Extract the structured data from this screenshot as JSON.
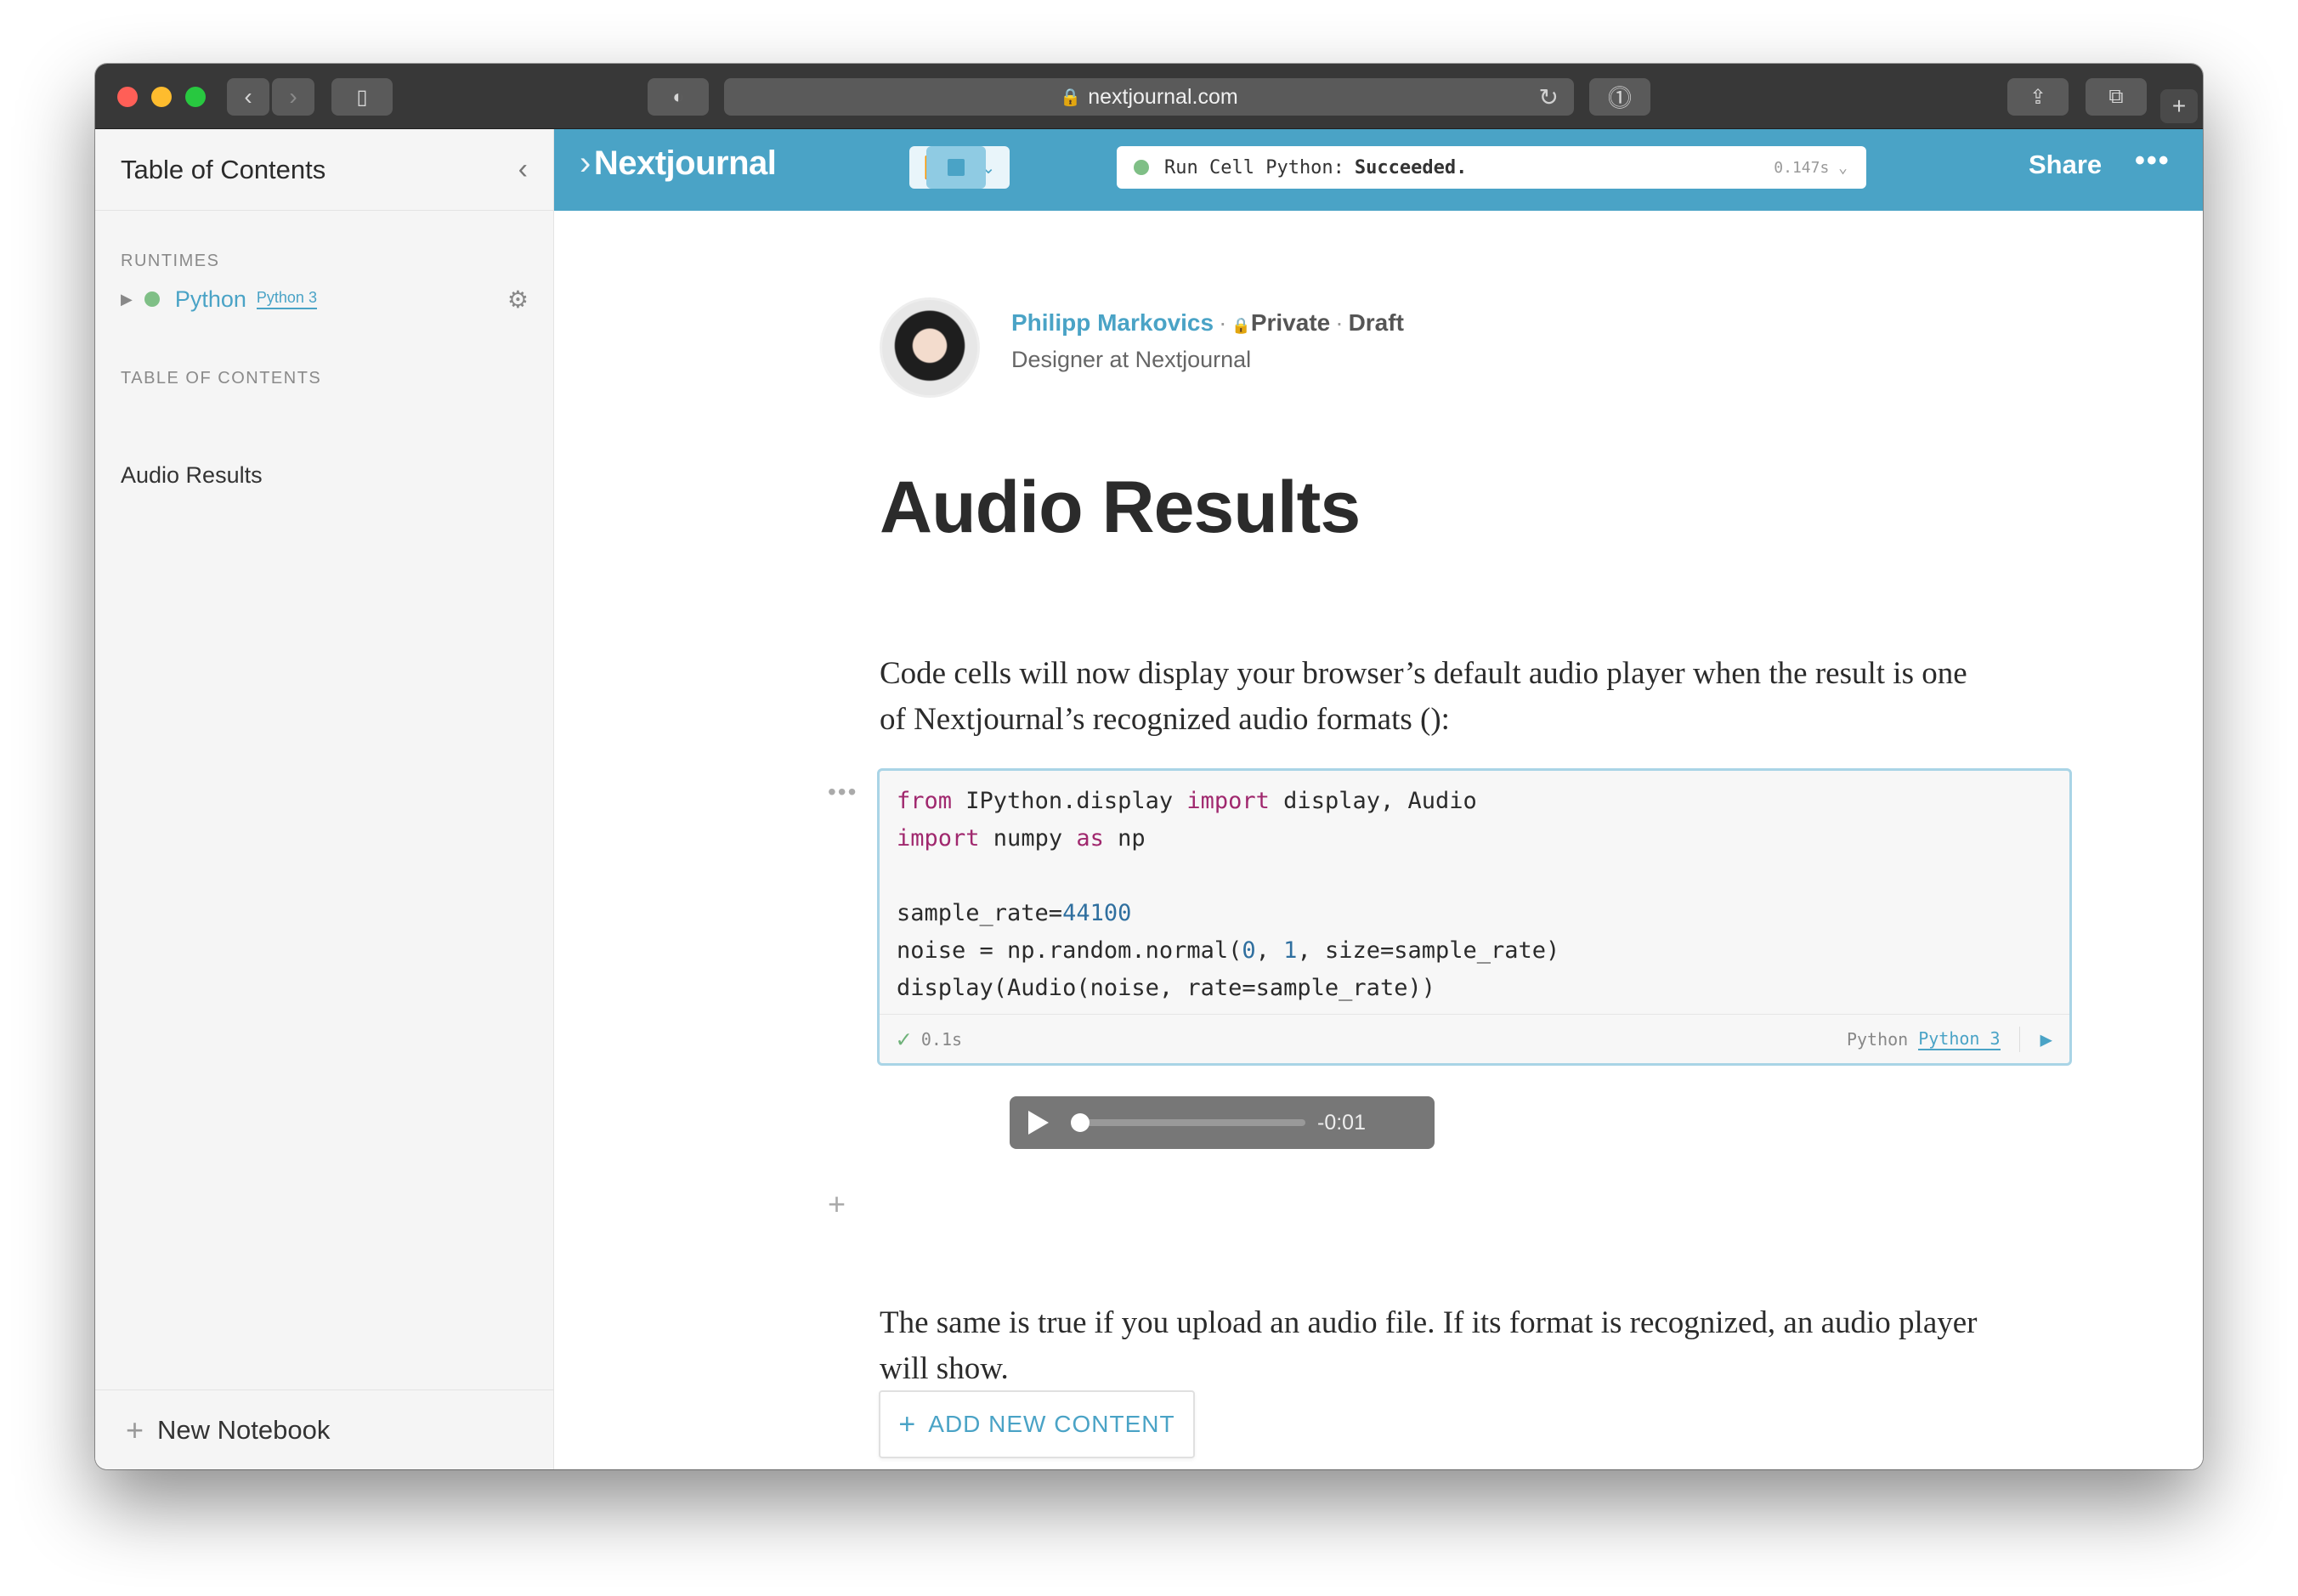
{
  "browser": {
    "url": "nextjournal.com",
    "colors": {
      "close": "#ff5f57",
      "minimize": "#febc2e",
      "maximize": "#28c840"
    }
  },
  "sidebar": {
    "title": "Table of Contents",
    "runtimes_heading": "RUNTIMES",
    "runtime": {
      "name": "Python",
      "badge": "Python 3",
      "status_color": "#7fbf86"
    },
    "toc_heading": "TABLE OF CONTENTS",
    "toc_items": [
      "Audio Results"
    ],
    "new_notebook": "New Notebook"
  },
  "toolbar": {
    "logo": "Nextjournal",
    "status_prefix": "Run Cell Python:",
    "status_result": "Succeeded.",
    "status_time": "0.147s",
    "share": "Share",
    "more": "•••",
    "accent": "#4aa3c6"
  },
  "article": {
    "author": "Philipp Markovics",
    "visibility": "Private",
    "state": "Draft",
    "role": "Designer at Nextjournal",
    "title": "Audio Results",
    "intro_line1": "Code cells will now display your browser’s default audio player when the result is one",
    "intro_line2": "of Nextjournal’s recognized audio formats ():",
    "code_cell": {
      "duration": "0.1s",
      "runtime": "Python",
      "runtime_badge": "Python 3"
    },
    "audio_time": "-0:01",
    "outro_line1": "The same is true if you upload an audio file. If its format is recognized, an audio player",
    "outro_line2": "will show.",
    "add_content": "ADD NEW CONTENT",
    "help": "?"
  }
}
